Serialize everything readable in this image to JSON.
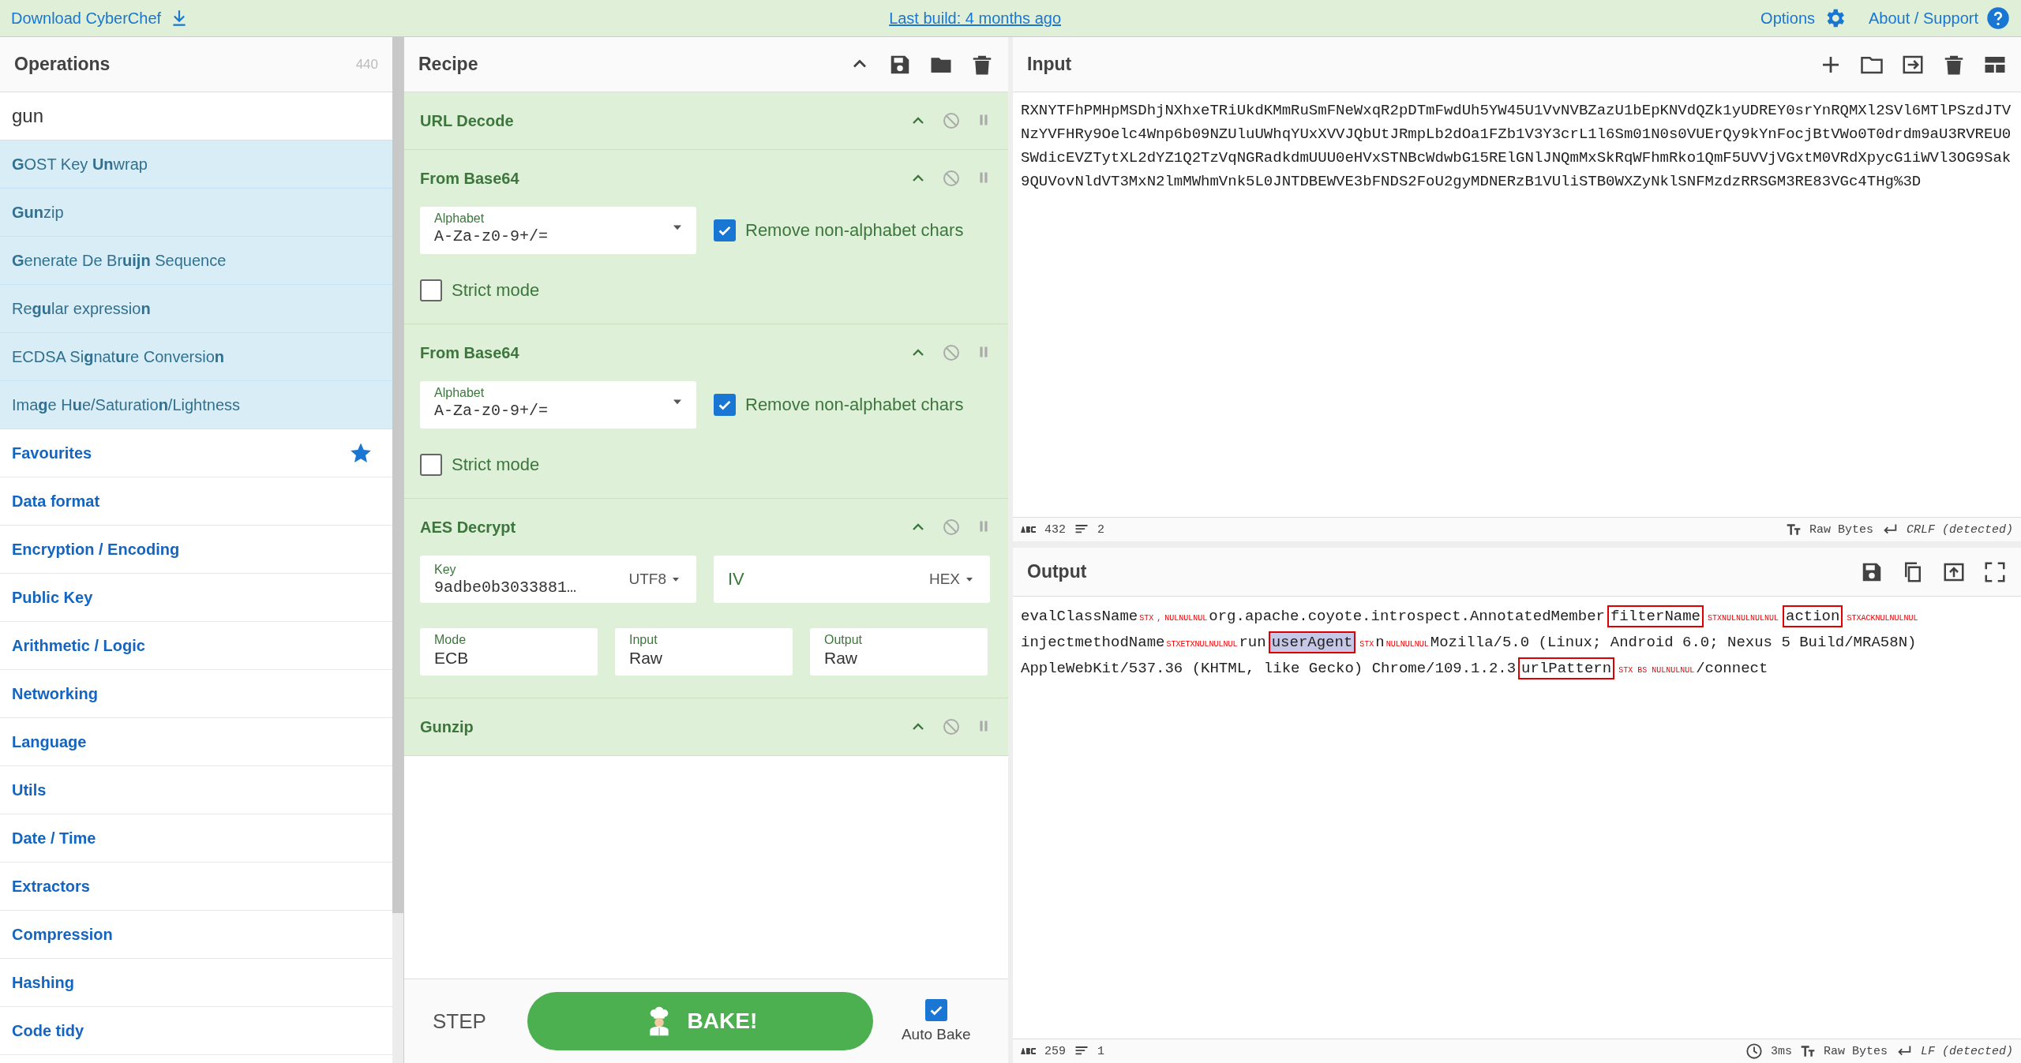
{
  "top_bar": {
    "download": "Download CyberChef",
    "last_build": "Last build: 4 months ago",
    "options": "Options",
    "about": "About / Support"
  },
  "operations": {
    "title": "Operations",
    "count": "440",
    "search": "gun",
    "results": [
      "**G**OST Key **Un**wrap",
      "**Gun**zip",
      "**G**enerate De Br**uijn** Sequence",
      "Re**gu**lar expressio**n**",
      "ECDSA Si**g**nat**u**re Conversio**n**",
      "Ima**g**e H**u**e/Saturatio**n**/Lightness"
    ],
    "categories": [
      {
        "label": "Favourites",
        "kind": "favourites"
      },
      {
        "label": "Data format",
        "kind": "category"
      },
      {
        "label": "Encryption / Encoding",
        "kind": "category"
      },
      {
        "label": "Public Key",
        "kind": "category"
      },
      {
        "label": "Arithmetic / Logic",
        "kind": "category"
      },
      {
        "label": "Networking",
        "kind": "category"
      },
      {
        "label": "Language",
        "kind": "category"
      },
      {
        "label": "Utils",
        "kind": "category"
      },
      {
        "label": "Date / Time",
        "kind": "category"
      },
      {
        "label": "Extractors",
        "kind": "category"
      },
      {
        "label": "Compression",
        "kind": "category"
      },
      {
        "label": "Hashing",
        "kind": "category"
      },
      {
        "label": "Code tidy",
        "kind": "category"
      }
    ]
  },
  "recipe": {
    "title": "Recipe",
    "operations": [
      {
        "name": "URL Decode"
      },
      {
        "name": "From Base64",
        "args": [
          {
            "kind": "dropdown",
            "label": "Alphabet",
            "value": "A-Za-z0-9+/="
          },
          {
            "kind": "checkbox",
            "label": "Remove non-alphabet chars",
            "checked": true
          },
          {
            "kind": "checkbox",
            "label": "Strict mode",
            "checked": false
          }
        ]
      },
      {
        "name": "From Base64",
        "args": [
          {
            "kind": "dropdown",
            "label": "Alphabet",
            "value": "A-Za-z0-9+/="
          },
          {
            "kind": "checkbox",
            "label": "Remove non-alphabet chars",
            "checked": true
          },
          {
            "kind": "checkbox",
            "label": "Strict mode",
            "checked": false
          }
        ]
      },
      {
        "name": "AES Decrypt",
        "args": [
          {
            "kind": "option-field",
            "label": "Key",
            "value": "9adbe0b3033881…",
            "option": "UTF8"
          },
          {
            "kind": "option-field",
            "placeholder": "IV",
            "option": "HEX"
          },
          {
            "kind": "field",
            "label": "Mode",
            "value": "ECB"
          },
          {
            "kind": "field",
            "label": "Input",
            "value": "Raw"
          },
          {
            "kind": "field",
            "label": "Output",
            "value": "Raw"
          }
        ]
      },
      {
        "name": "Gunzip"
      }
    ],
    "step": "STEP",
    "bake": "BAKE!",
    "auto_bake": {
      "label": "Auto Bake",
      "checked": true
    }
  },
  "input": {
    "title": "Input",
    "text": "RXNYTFhPMHpMSDhjNXhxeTRiUkdKMmRuSmFNeWxqR2pDTmFwdUh5YW45U1VvNVBZazU1bEpKNVdQZk1yUDREY0srYnRQMXl2SVl6MTlPSzdJTVNzYVFHRy9Oelc4Wnp6b09NZUluUWhqYUxXVVJQbUtJRmpLb2dOa1FZb1V3Y3crL1l6Sm01N0s0VUErQy9kYnFocjBtVWo0T0drdm9aU3RVREU0SWdicEVZTytXL2dYZ1Q2TzVqNGRadkdmUUU0eHVxSTNBcWdwbG15RElGNlJNQmMxSkRqWFhmRko1QmF5UVVjVGxtM0VRdXpycG1iWVl3OG9Sak9QUVovNldVT3MxN2lmMWhmVnk5L0JNTDBEWVE3bFNDS2FoU2gyMDNERzB1VUliSTB0WXZyNklSNFMzdzRRSGM3RE83VGc4THg%3D",
    "status": {
      "chars": "432",
      "lines": "2",
      "encoding": "Raw Bytes",
      "eol": "CRLF (detected)"
    }
  },
  "output": {
    "title": "Output",
    "lines": [
      [
        {
          "text": "evalClassName",
          "kind": "text"
        },
        {
          "text": "STX",
          "kind": "control"
        },
        {
          "text": ",",
          "kind": "control"
        },
        {
          "text": "NULNULNUL",
          "kind": "control"
        },
        {
          "text": "org.apache.coyote.introspect.AnnotatedMember",
          "kind": "text"
        },
        {
          "text": "filterName",
          "kind": "boxed"
        },
        {
          "text": "STXNULNULNULNUL",
          "kind": "control"
        },
        {
          "text": "action",
          "kind": "boxed"
        },
        {
          "text": "STXACKNULNULNUL",
          "kind": "control"
        }
      ],
      [
        {
          "text": "injectmethodName",
          "kind": "text"
        },
        {
          "text": "STXETXNULNULNUL",
          "kind": "control"
        },
        {
          "text": "run",
          "kind": "text"
        },
        {
          "text": "userAgent",
          "kind": "boxed-selected"
        },
        {
          "text": "STX",
          "kind": "control"
        },
        {
          "text": "n",
          "kind": "text"
        },
        {
          "text": "NULNULNUL",
          "kind": "control"
        },
        {
          "text": "Mozilla/5.0 (Linux; Android 6.0; Nexus 5 Build/MRA58N)",
          "kind": "text"
        }
      ],
      [
        {
          "text": "AppleWebKit/537.36 (KHTML, like Gecko) Chrome/109.1.2.3",
          "kind": "text"
        },
        {
          "text": "urlPattern",
          "kind": "boxed"
        },
        {
          "text": "STX BS NULNULNUL",
          "kind": "control"
        },
        {
          "text": "/connect",
          "kind": "text"
        }
      ]
    ],
    "status": {
      "chars": "259",
      "lines": "1",
      "time": "3ms",
      "encoding": "Raw Bytes",
      "eol": "LF (detected)"
    }
  }
}
